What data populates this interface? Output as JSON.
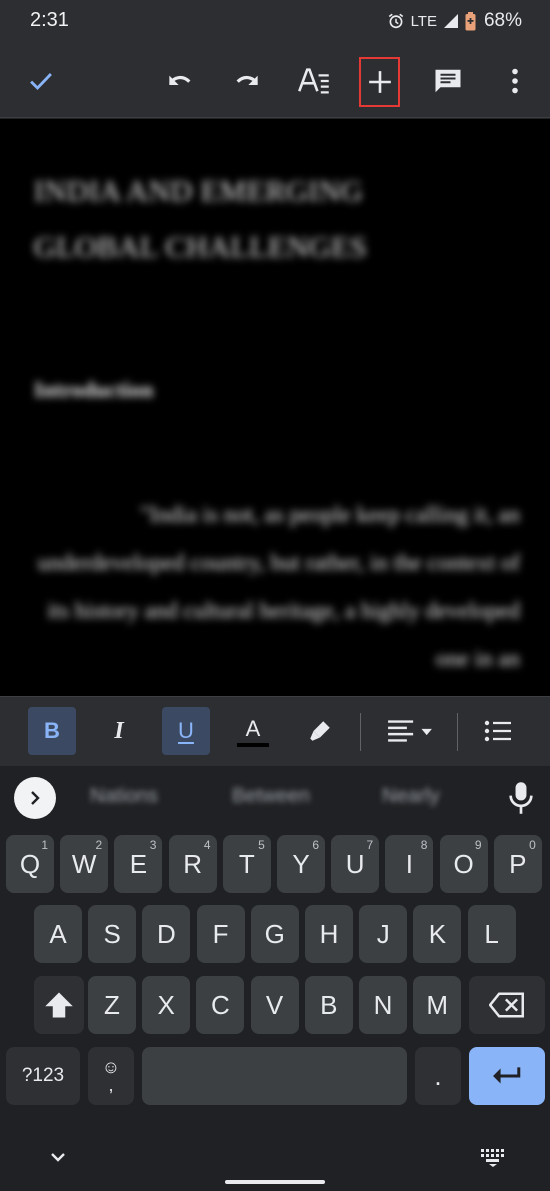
{
  "status_bar": {
    "time": "2:31",
    "network": "LTE",
    "battery": "68%",
    "icons": [
      "alarm-icon",
      "signal-icon",
      "battery-saver-icon"
    ]
  },
  "toolbar": {
    "buttons": [
      "check-icon",
      "undo-icon",
      "redo-icon",
      "text-format-icon",
      "insert-plus-icon",
      "comment-icon",
      "more-vert-icon"
    ],
    "highlight_color": "#e53935",
    "accent_color": "#8ab4f8"
  },
  "document": {
    "title": "INDIA AND EMERGING GLOBAL CHALLENGES",
    "heading": "Introduction",
    "paragraph": "\"India is not, as people keep calling it, an underdeveloped country, but rather, in the context of its history and cultural heritage, a highly developed one in an"
  },
  "format_bar": {
    "bold": "B",
    "italic": "I",
    "underline": "U",
    "text_color": "A",
    "states": {
      "bold": true,
      "italic": false,
      "underline": true
    },
    "icons": [
      "highlighter-icon",
      "align-left-icon",
      "bulleted-list-icon"
    ]
  },
  "keyboard": {
    "suggestions": [
      "Nations",
      "Between",
      "Nearly"
    ],
    "row1": [
      "Q",
      "W",
      "E",
      "R",
      "T",
      "Y",
      "U",
      "I",
      "O",
      "P"
    ],
    "row1_hints": [
      "1",
      "2",
      "3",
      "4",
      "5",
      "6",
      "7",
      "8",
      "9",
      "0"
    ],
    "row2": [
      "A",
      "S",
      "D",
      "F",
      "G",
      "H",
      "J",
      "K",
      "L"
    ],
    "row3": [
      "Z",
      "X",
      "C",
      "V",
      "B",
      "N",
      "M"
    ],
    "symbols_label": "?123",
    "emoji_label": "☺",
    "comma_label": ",",
    "period_label": ".",
    "enter_color": "#8ab4f8"
  }
}
